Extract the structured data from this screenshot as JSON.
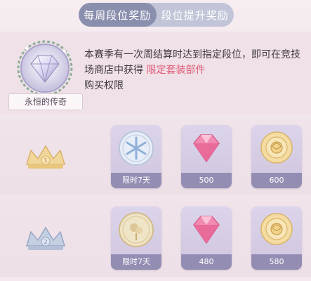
{
  "tabs": [
    {
      "label": "每周段位奖励",
      "active": true
    },
    {
      "label": "段位提升奖励",
      "active": false
    }
  ],
  "badge": {
    "name": "永恒的传奇",
    "icon": "diamond-wreath-badge-icon"
  },
  "description": {
    "line_before": "本赛季有一次周结算时达到指定段位，即可在竞技场商店中获得",
    "highlight": "限定套装部件",
    "line_after": "购买权限",
    "highlight_color": "#e05b76"
  },
  "tiers": [
    {
      "tier": "1",
      "crown": "gold-crown-icon",
      "rewards": [
        {
          "icon": "snowflake-coin-icon",
          "label": "限时7天"
        },
        {
          "icon": "pink-diamond-icon",
          "label": "500"
        },
        {
          "icon": "gold-rose-icon",
          "label": "600"
        }
      ]
    },
    {
      "tier": "2",
      "crown": "silver-crown-icon",
      "rewards": [
        {
          "icon": "flower-coin-icon",
          "label": "限时7天"
        },
        {
          "icon": "pink-diamond-icon",
          "label": "480"
        },
        {
          "icon": "gold-rose-icon",
          "label": "580"
        }
      ]
    }
  ]
}
